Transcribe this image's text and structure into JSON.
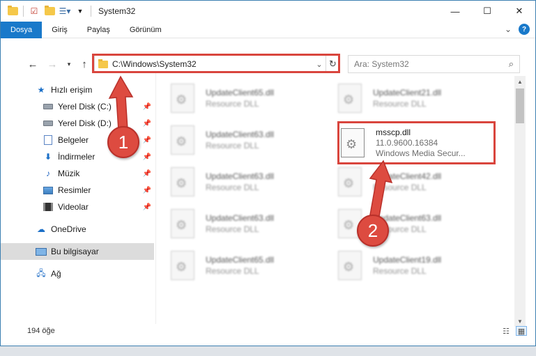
{
  "window": {
    "title": "System32",
    "controls": {
      "minimize": "—",
      "maximize": "☐",
      "close": "✕"
    }
  },
  "ribbon": {
    "tabs": [
      "Dosya",
      "Giriş",
      "Paylaş",
      "Görünüm"
    ],
    "expand_glyph": "⌄",
    "help_glyph": "?"
  },
  "address": {
    "path": "C:\\Windows\\System32",
    "search_placeholder": "Ara: System32"
  },
  "sidebar": {
    "items": [
      {
        "label": "Hızlı erişim",
        "icon": "star-icon",
        "pinned": false
      },
      {
        "label": "Yerel Disk (C:)",
        "icon": "drive-icon",
        "pinned": true
      },
      {
        "label": "Yerel Disk (D:)",
        "icon": "drive-icon",
        "pinned": true
      },
      {
        "label": "Belgeler",
        "icon": "documents-icon",
        "pinned": true
      },
      {
        "label": "İndirmeler",
        "icon": "downloads-icon",
        "pinned": true
      },
      {
        "label": "Müzik",
        "icon": "music-icon",
        "pinned": true
      },
      {
        "label": "Resimler",
        "icon": "pictures-icon",
        "pinned": true
      },
      {
        "label": "Videolar",
        "icon": "videos-icon",
        "pinned": true
      },
      {
        "label": "OneDrive",
        "icon": "cloud-icon",
        "pinned": false
      },
      {
        "label": "Bu bilgisayar",
        "icon": "computer-icon",
        "pinned": false,
        "selected": true
      },
      {
        "label": "Ağ",
        "icon": "network-icon",
        "pinned": false
      }
    ]
  },
  "files": {
    "left_column": [
      {
        "name": "UpdateClient65.dll",
        "sub": "Resource DLL"
      },
      {
        "name": "UpdateClient63.dll",
        "sub": "Resource DLL"
      },
      {
        "name": "UpdateClient63.dll",
        "sub": "Resource DLL"
      },
      {
        "name": "UpdateClient63.dll",
        "sub": "Resource DLL"
      },
      {
        "name": "UpdateClient65.dll",
        "sub": "Resource DLL"
      }
    ],
    "right_column": [
      {
        "name": "UpdateClient21.dll",
        "sub": "Resource DLL"
      },
      {
        "name": "msscp.dll",
        "sub": "11.0.9600.16384",
        "sub2": "Windows Media Secur..."
      },
      {
        "name": "UpdateClient42.dll",
        "sub": "Resource DLL"
      },
      {
        "name": "UpdateClient63.dll",
        "sub": "Resource DLL"
      },
      {
        "name": "UpdateClient19.dll",
        "sub": "Resource DLL"
      }
    ]
  },
  "status": {
    "item_count": "194 öğe"
  },
  "annotations": {
    "step1": "1",
    "step2": "2",
    "highlight_color": "#d9453d"
  }
}
